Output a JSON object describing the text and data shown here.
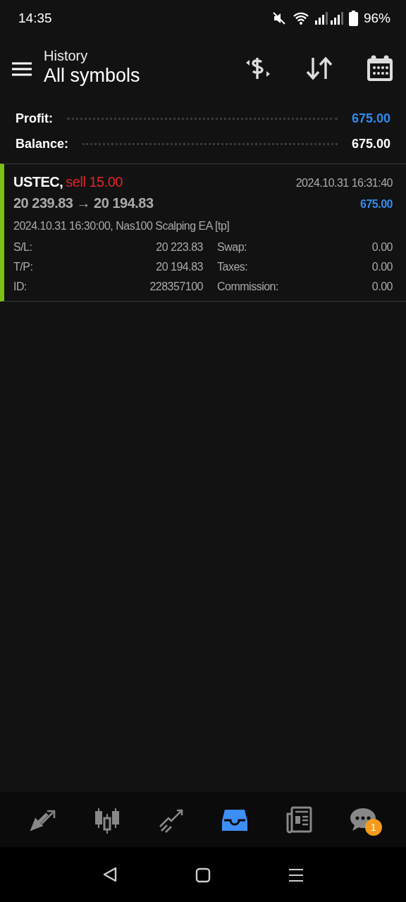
{
  "status_bar": {
    "time": "14:35",
    "battery": "96%"
  },
  "header": {
    "subtitle": "History",
    "title": "All symbols"
  },
  "summary": [
    {
      "label": "Profit:",
      "value": "675.00",
      "kind": "profit"
    },
    {
      "label": "Balance:",
      "value": "675.00",
      "kind": "plain"
    }
  ],
  "deals": [
    {
      "symbol": "USTEC,",
      "side": "sell 15.00",
      "kind": "sell",
      "time": "2024.10.31 16:31:40",
      "prices": "20 239.83 → 20 194.83",
      "profit": "675.00",
      "comment": "2024.10.31 16:30:00, Nas100 Scalping EA [tp]",
      "fields": [
        {
          "label": "S/L:",
          "value": "20 223.83"
        },
        {
          "label": "Swap:",
          "value": "0.00"
        },
        {
          "label": "T/P:",
          "value": "20 194.83"
        },
        {
          "label": "Taxes:",
          "value": "0.00"
        },
        {
          "label": "ID:",
          "value": "228357100"
        },
        {
          "label": "Commission:",
          "value": "0.00"
        }
      ]
    }
  ],
  "tabs": [
    {
      "kind": "quotes",
      "selected": false
    },
    {
      "kind": "chart",
      "selected": false
    },
    {
      "kind": "trade",
      "selected": false
    },
    {
      "kind": "history",
      "selected": true
    },
    {
      "kind": "news",
      "selected": false
    },
    {
      "kind": "chat",
      "selected": false,
      "badge": "1"
    }
  ]
}
